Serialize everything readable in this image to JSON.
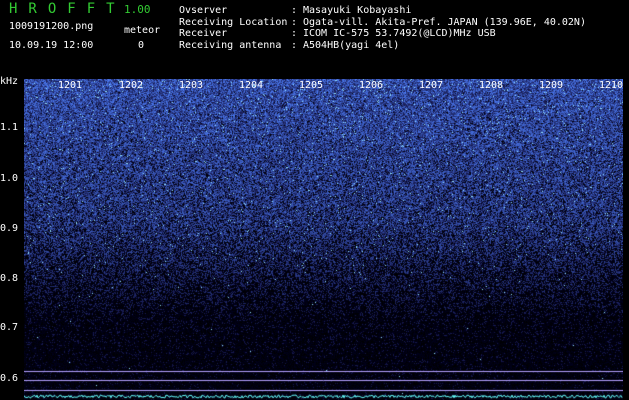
{
  "header": {
    "app_name": "HROFFT",
    "version": "1.00",
    "filename": "1009191200.png",
    "datetime": "10.09.19 12:00",
    "meteor_label": "meteor",
    "meteor_count": "0"
  },
  "info": [
    {
      "key": "Ovserver",
      "value": "Masayuki Kobayashi"
    },
    {
      "key": "Receiving Location",
      "value": "Ogata-vill. Akita-Pref. JAPAN (139.96E, 40.02N)"
    },
    {
      "key": "Receiver",
      "value": "ICOM IC-575 53.7492(@LCD)MHz USB"
    },
    {
      "key": "Receiving antenna",
      "value": "A504HB(yagi 4el)"
    }
  ],
  "separator": ":",
  "y_axis": {
    "unit": "kHz",
    "ticks": [
      "1.1",
      "1.0",
      "0.9",
      "0.8",
      "0.7",
      "0.6"
    ]
  },
  "x_axis": {
    "ticks": [
      "1201",
      "1202",
      "1203",
      "1204",
      "1205",
      "1206",
      "1207",
      "1208",
      "1209",
      "1210"
    ]
  },
  "colors": {
    "brand": "#33cc33",
    "background": "#000000",
    "noise_low": "#000050",
    "noise_high": "#3a5cff",
    "reference_line": "#b4a0ff"
  }
}
